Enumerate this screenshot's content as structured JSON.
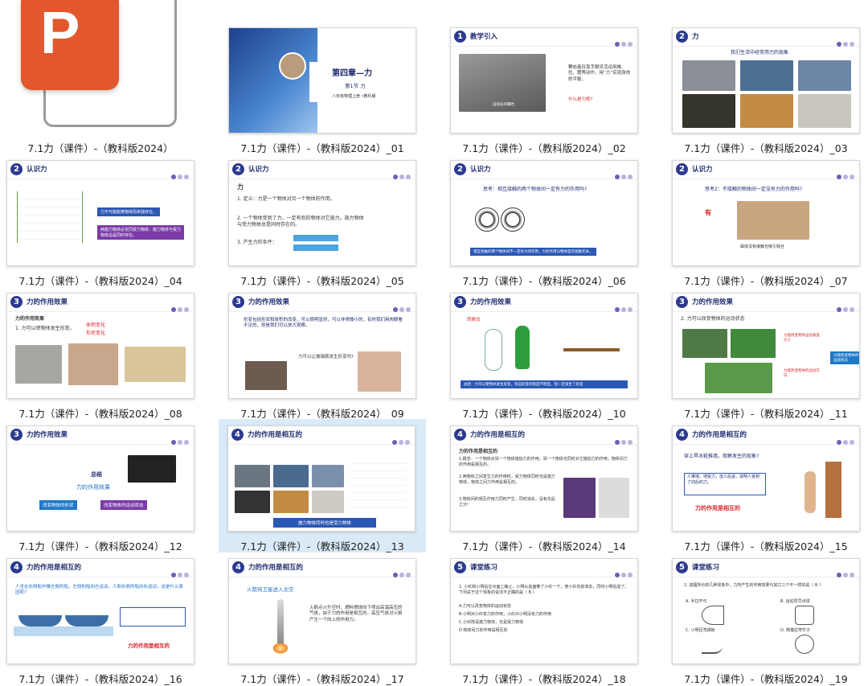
{
  "app_icon": {
    "letter": "P",
    "label": "PowerPoint file icon"
  },
  "files": [
    {
      "caption": "7.1力（课件）-（教科版2024）",
      "kind": "file"
    },
    {
      "caption": "7.1力（课件）-（教科版2024）_01",
      "kind": "cover",
      "title": "第四章—力",
      "subtitle": "第1节 力",
      "info": "八年级物理上册 •教科版"
    },
    {
      "caption": "7.1力（课件）-（教科版2024）_02",
      "section_num": "1",
      "section_title": "教学引入",
      "text": "攀岩者仅靠手脚灵活运用推、拉、蹬等动作，用“力”实现身体的平衡，",
      "question": "什么是力呢?",
      "img_label": "运动员的攀岩"
    },
    {
      "caption": "7.1力（课件）-（教科版2024）_03",
      "section_num": "2",
      "section_title": "力",
      "heading": "我们生活中经常用力的现象"
    },
    {
      "caption": "7.1力（课件）-（教科版2024）_04",
      "section_num": "2",
      "section_title": "认识力",
      "box1": "力不可能脱离物体而单独存在。",
      "box2": "两施力物体必定同受力物体，施力物体与受力物体总是同时存在。"
    },
    {
      "caption": "7.1力（课件）-（教科版2024）_05",
      "section_num": "2",
      "section_title": "认识力",
      "head": "力",
      "def": "1. 定义：力是一个物体对另一个物体的作用。",
      "p2": "2. 一个物体受到了力，一定有别的物体对它施力。施力物体与受力物体总是同时存在的。",
      "p3": "3. 产生力的条件："
    },
    {
      "caption": "7.1力（课件）-（教科版2024）_06",
      "section_num": "2",
      "section_title": "认识力",
      "q": "思考：相互接触的两个物体间一定有力的作用吗?",
      "box": "相互接触的两个物体间不一定有力的作用，力的作用与物体是否接触无关。"
    },
    {
      "caption": "7.1力（课件）-（教科版2024）_07",
      "section_num": "2",
      "section_title": "认识力",
      "q": "思考2：不接触的物体间一定没有力的作用吗?",
      "ans": "有",
      "img_label": "磁体没有接触也吸引铁丝"
    },
    {
      "caption": "7.1力（课件）-（教科版2024）_08",
      "section_num": "3",
      "section_title": "力的作用效果",
      "head": "力的作用效果",
      "p1": "1. 力可以使物体发生形变。",
      "tag1": "体积变化",
      "tag2": "形状变化"
    },
    {
      "caption": "7.1力（课件）-（教科版2024）_09",
      "section_num": "3",
      "section_title": "力的作用效果",
      "text": "形变包括形状和体积的改变，可以很明显的，可以非常微小的，有时我们用肉眼看不见的，但是我们可以放大观察。",
      "q": "力可以让玻璃瓶发生形变吗?"
    },
    {
      "caption": "7.1力（课件）-（教科版2024）_10",
      "section_num": "3",
      "section_title": "力的作用效果",
      "label": "转换法",
      "box": "总结：力可以使物体发生形变，有些形变的程度不明显，但一定发生了形变"
    },
    {
      "caption": "7.1力（课件）-（教科版2024）_11",
      "section_num": "3",
      "section_title": "力的作用效果",
      "p": "2. 力可以改变物体的运动状态",
      "b1": "力能改变物体运动速度大小",
      "b2": "力能改变物体的运动状态",
      "b3": "力能改变物体的运动方向"
    },
    {
      "caption": "7.1力（课件）-（教科版2024）_12",
      "section_num": "3",
      "section_title": "力的作用效果",
      "h": "总结",
      "s": "力的作用效果",
      "b1": "改变物体的形状",
      "b2": "改变物体的运动状态"
    },
    {
      "caption": "7.1力（课件）-（教科版2024）_13",
      "section_num": "4",
      "section_title": "力的作用是相互的",
      "box": "施力物体同时也是受力物体",
      "selected": true
    },
    {
      "caption": "7.1力（课件）-（教科版2024）_14",
      "section_num": "4",
      "section_title": "力的作用是相互的",
      "head": "力的作用是相互的",
      "p1": "1.概念：一个物体对另一个物体施加力的作用，另一个物体也同时对它施加力的作用，物体间力的作用是相互的。",
      "p2": "2.两物体之间发生力的作用时，受力物体同时也是施力物体，物体之间力作用是相互的。",
      "p3": "3.物体间的相互作用力同时产生，同时消失，没有先后之分!"
    },
    {
      "caption": "7.1力（课件）-（教科版2024）_15",
      "section_num": "4",
      "section_title": "力的作用是相互的",
      "q": "穿上旱冰鞋推墙，观察发生的现象?",
      "box": "人推墙，墙受力，但人后退，说明人受到了向后的力。",
      "conc": "力的作用是相互的"
    },
    {
      "caption": "7.1力（课件）-（教科版2024）_16",
      "section_num": "4",
      "section_title": "力的作用是相互的",
      "q": "人坐在右侧船中推左侧的船，左侧的船向左运动，人和右侧的船向右运动，这是什么原因呢?",
      "conc": "力的作用是相互的"
    },
    {
      "caption": "7.1力（课件）-（教科版2024）_17",
      "section_num": "4",
      "section_title": "力的作用是相互的",
      "h": "火箭将卫星送入太空",
      "text": "火箭点火升空时，燃料燃烧向下喷出高温高压的气体，由于力的作用是相互的，高压气体对火箭产生一个向上的作用力。"
    },
    {
      "caption": "7.1力（课件）-（教科版2024）_18",
      "section_num": "5",
      "section_title": "课堂练习",
      "q": "1. 小红和小明站在冰面上静止，小明从后面推了小红一下，使小红向前滑去，同时小明后退了。下列关于这个现象的说法不正确的是（ B ）",
      "a": "A.力可以改变物体的运动状态",
      "b": "B.小明对小红有力的作用，小红对小明没有力的作用",
      "c": "C.小红既是施力物体，也是受力物体",
      "d": "D.物体间力的作用是相互的"
    },
    {
      "caption": "7.1力（课件）-（教科版2024）_19",
      "section_num": "5",
      "section_title": "课堂练习",
      "q": "2. 如图所示的几种现象中，力所产生的作用效果与其它三个不一样的是（ B ）",
      "a": "A. 手拉开弓",
      "b": "B. 运动员罚点球",
      "c": "C. 小明压弯跳板",
      "d": "D. 熊猫拉弯竹子"
    }
  ],
  "colors": {
    "navy": "#2b3a8f",
    "blue_btn": "#1f78c8",
    "red": "#d8232a",
    "selection": "#dbeaf8",
    "ppt_orange": "#e2572c"
  }
}
